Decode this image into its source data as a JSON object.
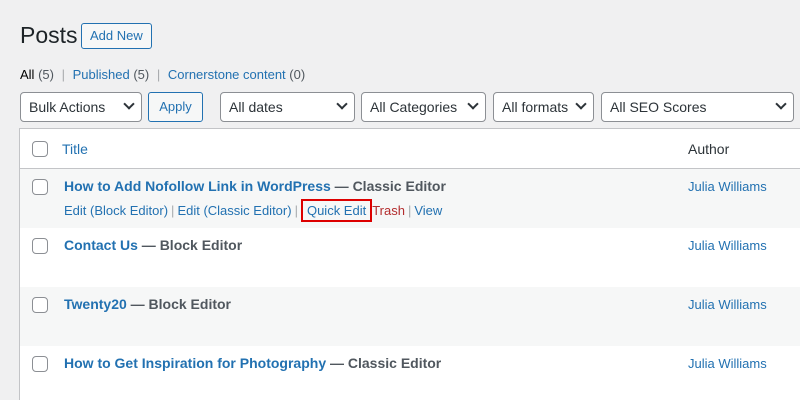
{
  "header": {
    "title": "Posts",
    "add_new_label": "Add New"
  },
  "filters": {
    "all_label": "All",
    "all_count": "(5)",
    "published_label": "Published",
    "published_count": "(5)",
    "cornerstone_label": "Cornerstone content",
    "cornerstone_count": "(0)"
  },
  "tablenav": {
    "bulk_actions": "Bulk Actions",
    "apply": "Apply",
    "dates": "All dates",
    "categories": "All Categories",
    "formats": "All formats",
    "seo": "All SEO Scores"
  },
  "table": {
    "col_title": "Title",
    "col_author": "Author",
    "rows": [
      {
        "title": "How to Add Nofollow Link in WordPress",
        "state": "Classic Editor",
        "author": "Julia Williams",
        "actions": {
          "edit_block": "Edit (Block Editor)",
          "edit_classic": "Edit (Classic Editor)",
          "quick_edit": "Quick Edit",
          "trash": "Trash",
          "view": "View"
        }
      },
      {
        "title": "Contact Us",
        "state": "Block Editor",
        "author": "Julia Williams"
      },
      {
        "title": "Twenty20",
        "state": "Block Editor",
        "author": "Julia Williams"
      },
      {
        "title": "How to Get Inspiration for Photography",
        "state": "Classic Editor",
        "author": "Julia Williams"
      }
    ]
  },
  "colors": {
    "link": "#2271b1",
    "trash": "#b32d2e",
    "highlight": "#dd0000",
    "background": "#f0f0f1"
  }
}
